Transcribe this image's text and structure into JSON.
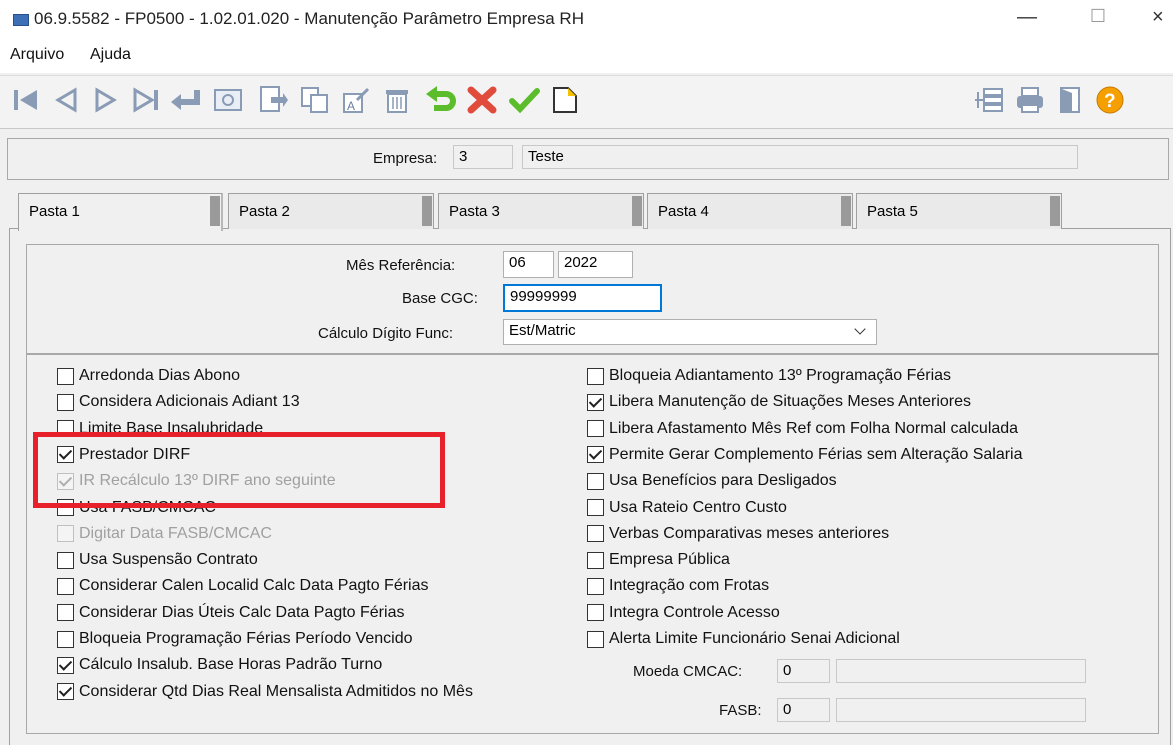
{
  "window": {
    "title": "06.9.5582 - FP0500 - 1.02.01.020 - Manutenção Parâmetro Empresa RH",
    "min": "—",
    "max": "☐",
    "close": "×"
  },
  "menu": [
    "Arquivo",
    "Ajuda"
  ],
  "toolbar": {
    "icons": [
      "first-record-icon",
      "previous-record-icon",
      "next-record-icon",
      "last-record-icon",
      "goto-enter-icon",
      "search-zoom-icon",
      "new-record-icon",
      "copy-record-icon",
      "edit-record-icon",
      "delete-record-icon",
      "undo-icon",
      "cancel-icon",
      "save-confirm-icon",
      "new-document-icon",
      "tree-structure-icon",
      "print-icon",
      "exit-door-icon",
      "help-icon"
    ]
  },
  "header": {
    "empresa_label": "Empresa:",
    "empresa_code": "3",
    "empresa_name": "Teste"
  },
  "tabs": [
    "Pasta 1",
    "Pasta 2",
    "Pasta 3",
    "Pasta 4",
    "Pasta 5"
  ],
  "form": {
    "mes_label": "Mês Referência:",
    "mes_value": "06",
    "ano_value": "2022",
    "cgc_label": "Base CGC:",
    "cgc_value": "99999999",
    "calc_label": "Cálculo Dígito Func:",
    "calc_value": "Est/Matric"
  },
  "left_checks": [
    {
      "label": "Arredonda Dias Abono",
      "checked": false,
      "disabled": false
    },
    {
      "label": "Considera Adicionais Adiant 13",
      "checked": false,
      "disabled": false
    },
    {
      "label": "Limite Base Insalubridade",
      "checked": false,
      "disabled": false
    },
    {
      "label": "Prestador DIRF",
      "checked": true,
      "disabled": false
    },
    {
      "label": "IR Recálculo 13º DIRF ano seguinte",
      "checked": true,
      "disabled": true
    },
    {
      "label": "Usa FASB/CMCAC",
      "checked": false,
      "disabled": false
    },
    {
      "label": "Digitar Data FASB/CMCAC",
      "checked": false,
      "disabled": true
    },
    {
      "label": "Usa Suspensão Contrato",
      "checked": false,
      "disabled": false
    },
    {
      "label": "Considerar Calen Localid Calc Data Pagto Férias",
      "checked": false,
      "disabled": false
    },
    {
      "label": "Considerar Dias Úteis Calc Data Pagto Férias",
      "checked": false,
      "disabled": false
    },
    {
      "label": "Bloqueia Programação Férias Período Vencido",
      "checked": false,
      "disabled": false
    },
    {
      "label": "Cálculo Insalub. Base Horas Padrão Turno",
      "checked": true,
      "disabled": false
    },
    {
      "label": "Considerar Qtd Dias Real Mensalista Admitidos no Mês",
      "checked": true,
      "disabled": false
    }
  ],
  "right_checks": [
    {
      "label": "Bloqueia Adiantamento 13º Programação Férias",
      "checked": false
    },
    {
      "label": "Libera Manutenção de Situações Meses Anteriores",
      "checked": true
    },
    {
      "label": "Libera Afastamento Mês Ref com Folha Normal calculada",
      "checked": false
    },
    {
      "label": "Permite Gerar Complemento Férias sem Alteração Salaria",
      "checked": true
    },
    {
      "label": "Usa Benefícios para Desligados",
      "checked": false
    },
    {
      "label": "Usa Rateio Centro Custo",
      "checked": false
    },
    {
      "label": "Verbas Comparativas meses anteriores",
      "checked": false
    },
    {
      "label": "Empresa Pública",
      "checked": false
    },
    {
      "label": "Integração com Frotas",
      "checked": false
    },
    {
      "label": "Integra Controle Acesso",
      "checked": false
    },
    {
      "label": "Alerta Limite Funcionário Senai Adicional",
      "checked": false
    }
  ],
  "moeda": {
    "label": "Moeda CMCAC:",
    "value": "0",
    "desc": ""
  },
  "fasb": {
    "label": "FASB:",
    "value": "0",
    "desc": ""
  }
}
